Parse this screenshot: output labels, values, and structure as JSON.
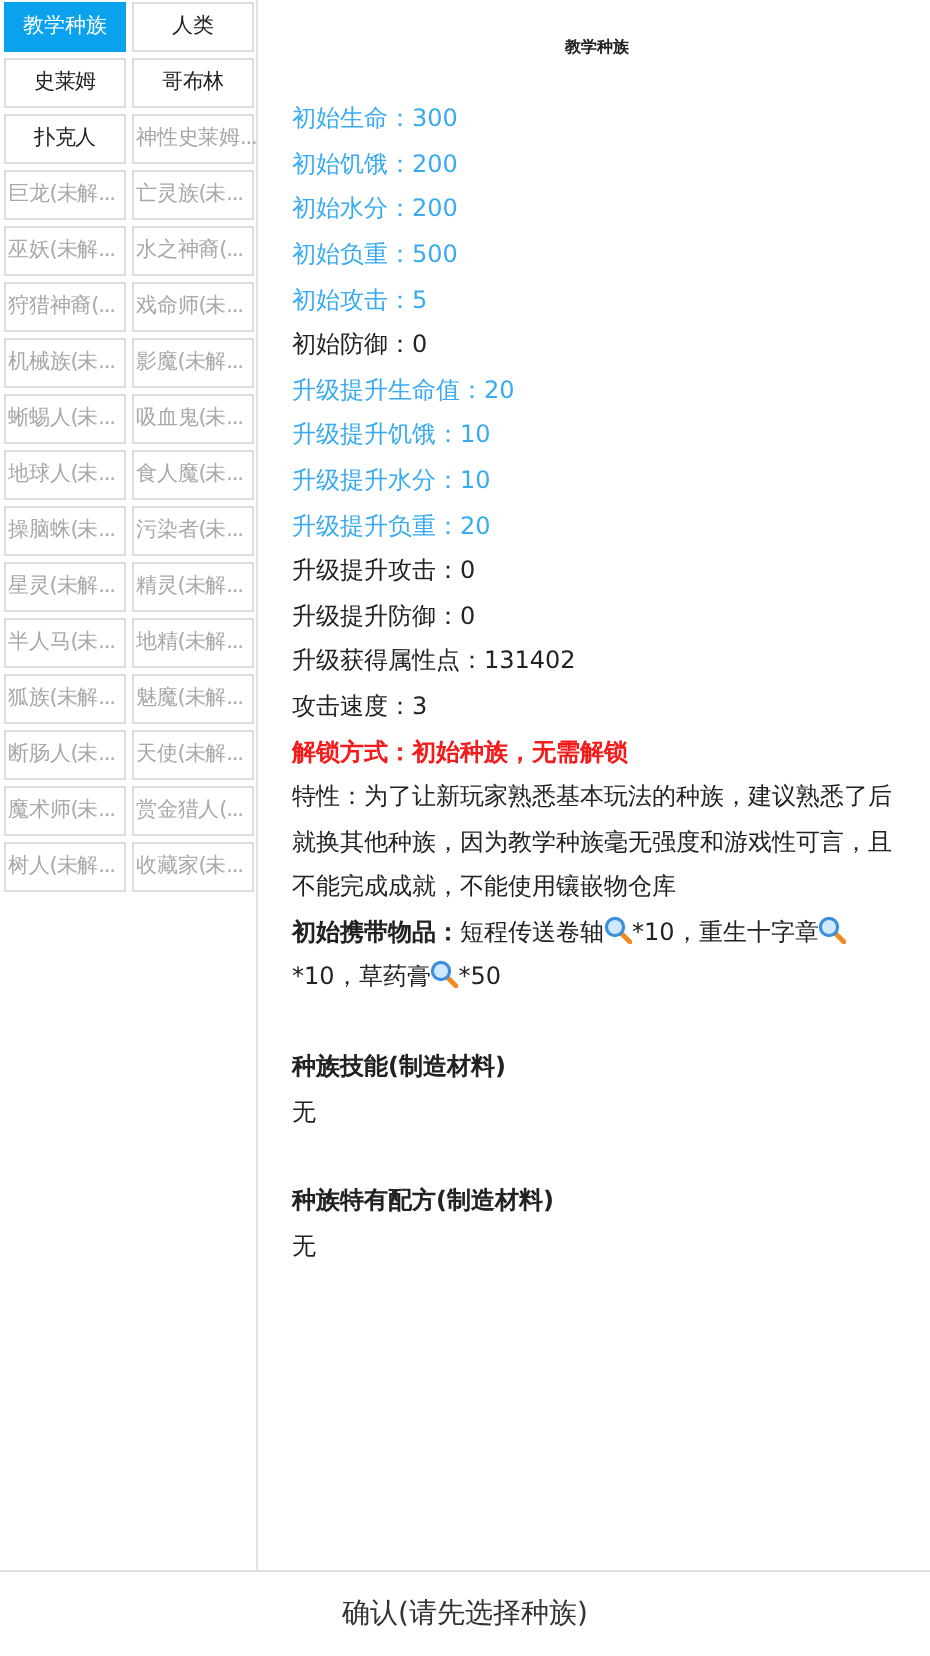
{
  "races": [
    {
      "name": "教学种族",
      "selected": true,
      "locked": false
    },
    {
      "name": "人类",
      "selected": false,
      "locked": false
    },
    {
      "name": "史莱姆",
      "selected": false,
      "locked": false
    },
    {
      "name": "哥布林",
      "selected": false,
      "locked": false
    },
    {
      "name": "扑克人",
      "selected": false,
      "locked": false
    },
    {
      "name": "神性史莱姆...",
      "selected": false,
      "locked": true
    },
    {
      "name": "巨龙(未解...",
      "selected": false,
      "locked": true
    },
    {
      "name": "亡灵族(未...",
      "selected": false,
      "locked": true
    },
    {
      "name": "巫妖(未解...",
      "selected": false,
      "locked": true
    },
    {
      "name": "水之神裔(...",
      "selected": false,
      "locked": true
    },
    {
      "name": "狩猎神裔(...",
      "selected": false,
      "locked": true
    },
    {
      "name": "戏命师(未...",
      "selected": false,
      "locked": true
    },
    {
      "name": "机械族(未...",
      "selected": false,
      "locked": true
    },
    {
      "name": "影魔(未解...",
      "selected": false,
      "locked": true
    },
    {
      "name": "蜥蜴人(未...",
      "selected": false,
      "locked": true
    },
    {
      "name": "吸血鬼(未...",
      "selected": false,
      "locked": true
    },
    {
      "name": "地球人(未...",
      "selected": false,
      "locked": true
    },
    {
      "name": "食人魔(未...",
      "selected": false,
      "locked": true
    },
    {
      "name": "操脑蛛(未...",
      "selected": false,
      "locked": true
    },
    {
      "name": "污染者(未...",
      "selected": false,
      "locked": true
    },
    {
      "name": "星灵(未解...",
      "selected": false,
      "locked": true
    },
    {
      "name": "精灵(未解...",
      "selected": false,
      "locked": true
    },
    {
      "name": "半人马(未...",
      "selected": false,
      "locked": true
    },
    {
      "name": "地精(未解...",
      "selected": false,
      "locked": true
    },
    {
      "name": "狐族(未解...",
      "selected": false,
      "locked": true
    },
    {
      "name": "魅魔(未解...",
      "selected": false,
      "locked": true
    },
    {
      "name": "断肠人(未...",
      "selected": false,
      "locked": true
    },
    {
      "name": "天使(未解...",
      "selected": false,
      "locked": true
    },
    {
      "name": "魔术师(未...",
      "selected": false,
      "locked": true
    },
    {
      "name": "赏金猎人(...",
      "selected": false,
      "locked": true
    },
    {
      "name": "树人(未解...",
      "selected": false,
      "locked": true
    },
    {
      "name": "收藏家(未...",
      "selected": false,
      "locked": true
    }
  ],
  "detail": {
    "title": "教学种族",
    "stats": [
      {
        "text": "初始生命：300",
        "highlighted": true
      },
      {
        "text": "初始饥饿：200",
        "highlighted": true
      },
      {
        "text": "初始水分：200",
        "highlighted": true
      },
      {
        "text": "初始负重：500",
        "highlighted": true
      },
      {
        "text": "初始攻击：5",
        "highlighted": true
      },
      {
        "text": "初始防御：0",
        "highlighted": false
      },
      {
        "text": "升级提升生命值：20",
        "highlighted": true
      },
      {
        "text": "升级提升饥饿：10",
        "highlighted": true
      },
      {
        "text": "升级提升水分：10",
        "highlighted": true
      },
      {
        "text": "升级提升负重：20",
        "highlighted": true
      },
      {
        "text": "升级提升攻击：0",
        "highlighted": false
      },
      {
        "text": "升级提升防御：0",
        "highlighted": false
      },
      {
        "text": "升级获得属性点：131402",
        "highlighted": false
      },
      {
        "text": "攻击速度：3",
        "highlighted": false
      }
    ],
    "unlock": "解锁方式：初始种族，无需解锁",
    "trait": "特性：为了让新玩家熟悉基本玩法的种族，建议熟悉了后就换其他种族，因为教学种族毫无强度和游戏性可言，且不能完成成就，不能使用镶嵌物仓库",
    "items_label": "初始携带物品：",
    "items": [
      {
        "name": "短程传送卷轴",
        "count": "*10，"
      },
      {
        "name": "重生十字章",
        "count": "*10，"
      },
      {
        "name": "草药膏",
        "count": "*50"
      }
    ],
    "sections": [
      {
        "heading": "种族技能(制造材料)",
        "body": "无"
      },
      {
        "heading": "种族特有配方(制造材料)",
        "body": "无"
      }
    ]
  },
  "confirm": "确认(请先选择种族)"
}
